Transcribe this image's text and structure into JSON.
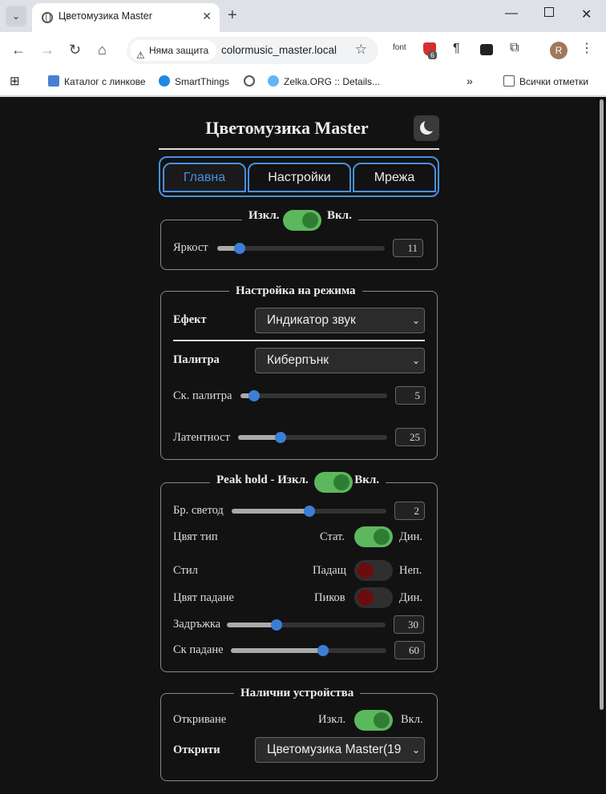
{
  "browser": {
    "tab_title": "Цветомузика Master",
    "security_label": "Няма защита",
    "url": "colormusic_master.local",
    "ext_font": "font",
    "ext_badge": "6",
    "avatar_letter": "R",
    "bookmarks": [
      "Каталог с линкове",
      "SmartThings",
      "Zelka.ORG :: Details...",
      "Всички отметки"
    ]
  },
  "page": {
    "title": "Цветомузика Master",
    "tabs": [
      "Главна",
      "Настройки",
      "Мрежа"
    ],
    "power": {
      "off": "Изкл.",
      "on": "Вкл.",
      "state": "on"
    },
    "brightness": {
      "label": "Яркост",
      "value": "11",
      "fraction": 0.11
    },
    "mode": {
      "legend": "Настройка на режима",
      "effect_label": "Ефект",
      "effect_value": "Индикатор звук",
      "palette_label": "Палитра",
      "palette_value": "Киберпънк",
      "palette_speed_label": "Ск. палитра",
      "palette_speed_value": "5",
      "palette_speed_fraction": 0.06,
      "latency_label": "Латентност",
      "latency_value": "25",
      "latency_fraction": 0.27
    },
    "peak": {
      "legend": "Peak hold - Изкл.",
      "legend_on": "Вкл.",
      "state": "on",
      "leds_label": "Бр. светод",
      "leds_value": "2",
      "leds_fraction": 0.5,
      "color_type_label": "Цвят тип",
      "color_type_left": "Стат.",
      "color_type_right": "Дин.",
      "color_type_state": "on",
      "style_label": "Стил",
      "style_left": "Падащ",
      "style_right": "Неп.",
      "style_state": "off",
      "fall_color_label": "Цвят падане",
      "fall_color_left": "Пиков",
      "fall_color_right": "Дин.",
      "fall_color_state": "off",
      "delay_label": "Задръжка",
      "delay_value": "30",
      "delay_fraction": 0.3,
      "fall_speed_label": "Ск падане",
      "fall_speed_value": "60",
      "fall_speed_fraction": 0.6
    },
    "devices": {
      "legend": "Налични устройства",
      "discovery_label": "Откриване",
      "discovery_left": "Изкл.",
      "discovery_right": "Вкл.",
      "discovery_state": "on",
      "found_label": "Открити",
      "found_value": "Цветомузика Master(19"
    }
  }
}
